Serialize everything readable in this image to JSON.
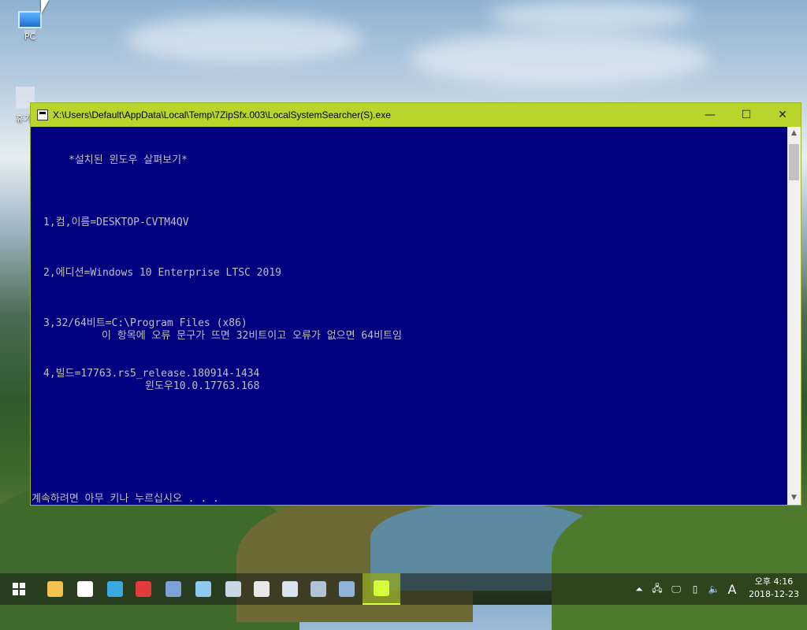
{
  "desktop": {
    "icons": [
      {
        "label": "PC"
      },
      {
        "label": "휴기"
      }
    ]
  },
  "window": {
    "title": "X:\\Users\\Default\\AppData\\Local\\Temp\\7ZipSfx.003\\LocalSystemSearcher(S).exe",
    "minimize_glyph": "—",
    "maximize_glyph": "☐",
    "close_glyph": "✕",
    "colors": {
      "titlebar": "#b9d42b",
      "console_bg": "#000080",
      "console_text": "#c0c0c0"
    }
  },
  "console": {
    "heading": "*설치된 윈도우 살펴보기*",
    "line1": "1,컴,이름=DESKTOP-CVTM4QV",
    "line2": "2,에디션=Windows 10 Enterprise LTSC 2019",
    "line3a": "3,32/64비트=C:\\Program Files (x86)",
    "line3b": "이 항목에 오류 문구가 뜨면 32비트이고 오류가 없으면 64비트임",
    "line4a": "4,빌드=17763.rs5_release.180914-1434",
    "line4b": "윈도우10.0.17763.168",
    "prompt": "계속하려면 아무 키나 누르십시오 . . ."
  },
  "taskbar": {
    "items": [
      {
        "name": "file-explorer-icon",
        "color": "#f2c14e"
      },
      {
        "name": "settings-gear-icon",
        "color": "#ffffff"
      },
      {
        "name": "bird-app-icon",
        "color": "#3aa9e0"
      },
      {
        "name": "browser-icon",
        "color": "#e23b3b"
      },
      {
        "name": "network-tool-icon",
        "color": "#7aa2d8"
      },
      {
        "name": "document-app-icon",
        "color": "#8ec9f0"
      },
      {
        "name": "monitor-app-icon",
        "color": "#c9d6e6"
      },
      {
        "name": "disc-icon",
        "color": "#e8e8e8"
      },
      {
        "name": "terminal-app-icon",
        "color": "#d8e3ee"
      },
      {
        "name": "installer-icon",
        "color": "#b0c4d8"
      },
      {
        "name": "remote-desktop-icon",
        "color": "#8fb3d9"
      },
      {
        "name": "searcher-app-icon",
        "color": "#d4ff3a"
      }
    ],
    "tray": {
      "ime_label": "A",
      "clock_period_time": "오후 4:16",
      "clock_date": "2018-12-23"
    }
  }
}
